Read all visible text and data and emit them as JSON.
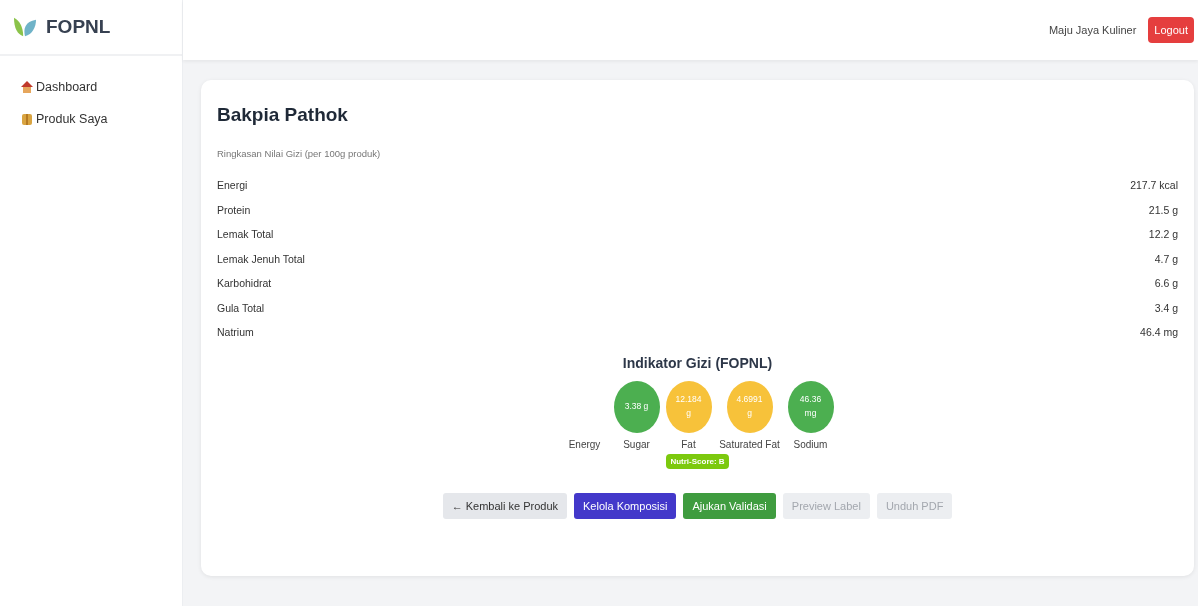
{
  "brand": "FOPNL",
  "sidebar": {
    "items": [
      {
        "label": "Dashboard",
        "kind": "house",
        "selected": false
      },
      {
        "label": "Produk Saya",
        "kind": "box",
        "selected": false
      }
    ]
  },
  "header": {
    "user": "Maju Jaya Kuliner",
    "logout": "Logout"
  },
  "product": {
    "title": "Bakpia Pathok",
    "subtitle": "Ringkasan Nilai Gizi (per 100g produk)",
    "nutrients": [
      {
        "name": "Energi",
        "value": "217.7 kcal"
      },
      {
        "name": "Protein",
        "value": "21.5 g"
      },
      {
        "name": "Lemak Total",
        "value": "12.2 g"
      },
      {
        "name": "Lemak Jenuh Total",
        "value": "4.7 g"
      },
      {
        "name": "Karbohidrat",
        "value": "6.6 g"
      },
      {
        "name": "Gula Total",
        "value": "3.4 g"
      },
      {
        "name": "Natrium",
        "value": "46.4 mg"
      }
    ]
  },
  "indicators": {
    "title": "Indikator Gizi (FOPNL)",
    "items": [
      {
        "label": "Energy"
      },
      {
        "label": "Sugar",
        "value": "3.38 g",
        "color": "#4caf50"
      },
      {
        "label": "Fat",
        "value": "12.184 g",
        "color": "#f7c23a"
      },
      {
        "label": "Saturated Fat",
        "value": "4.6991 g",
        "color": "#f7c23a"
      },
      {
        "label": "Sodium",
        "value": "46.36 mg",
        "color": "#4caf50"
      }
    ],
    "nutri_score": "Nutri-Score: B"
  },
  "buttons": [
    {
      "label": "← Kembali ke Produk",
      "kind": "secondary",
      "disabled": false
    },
    {
      "label": "Kelola Komposisi",
      "kind": "primary",
      "disabled": false
    },
    {
      "label": "Ajukan Validasi",
      "kind": "success",
      "disabled": false
    },
    {
      "label": "Preview Label",
      "kind": "secondary",
      "disabled": true
    },
    {
      "label": "Unduh PDF",
      "kind": "secondary",
      "disabled": true
    }
  ]
}
